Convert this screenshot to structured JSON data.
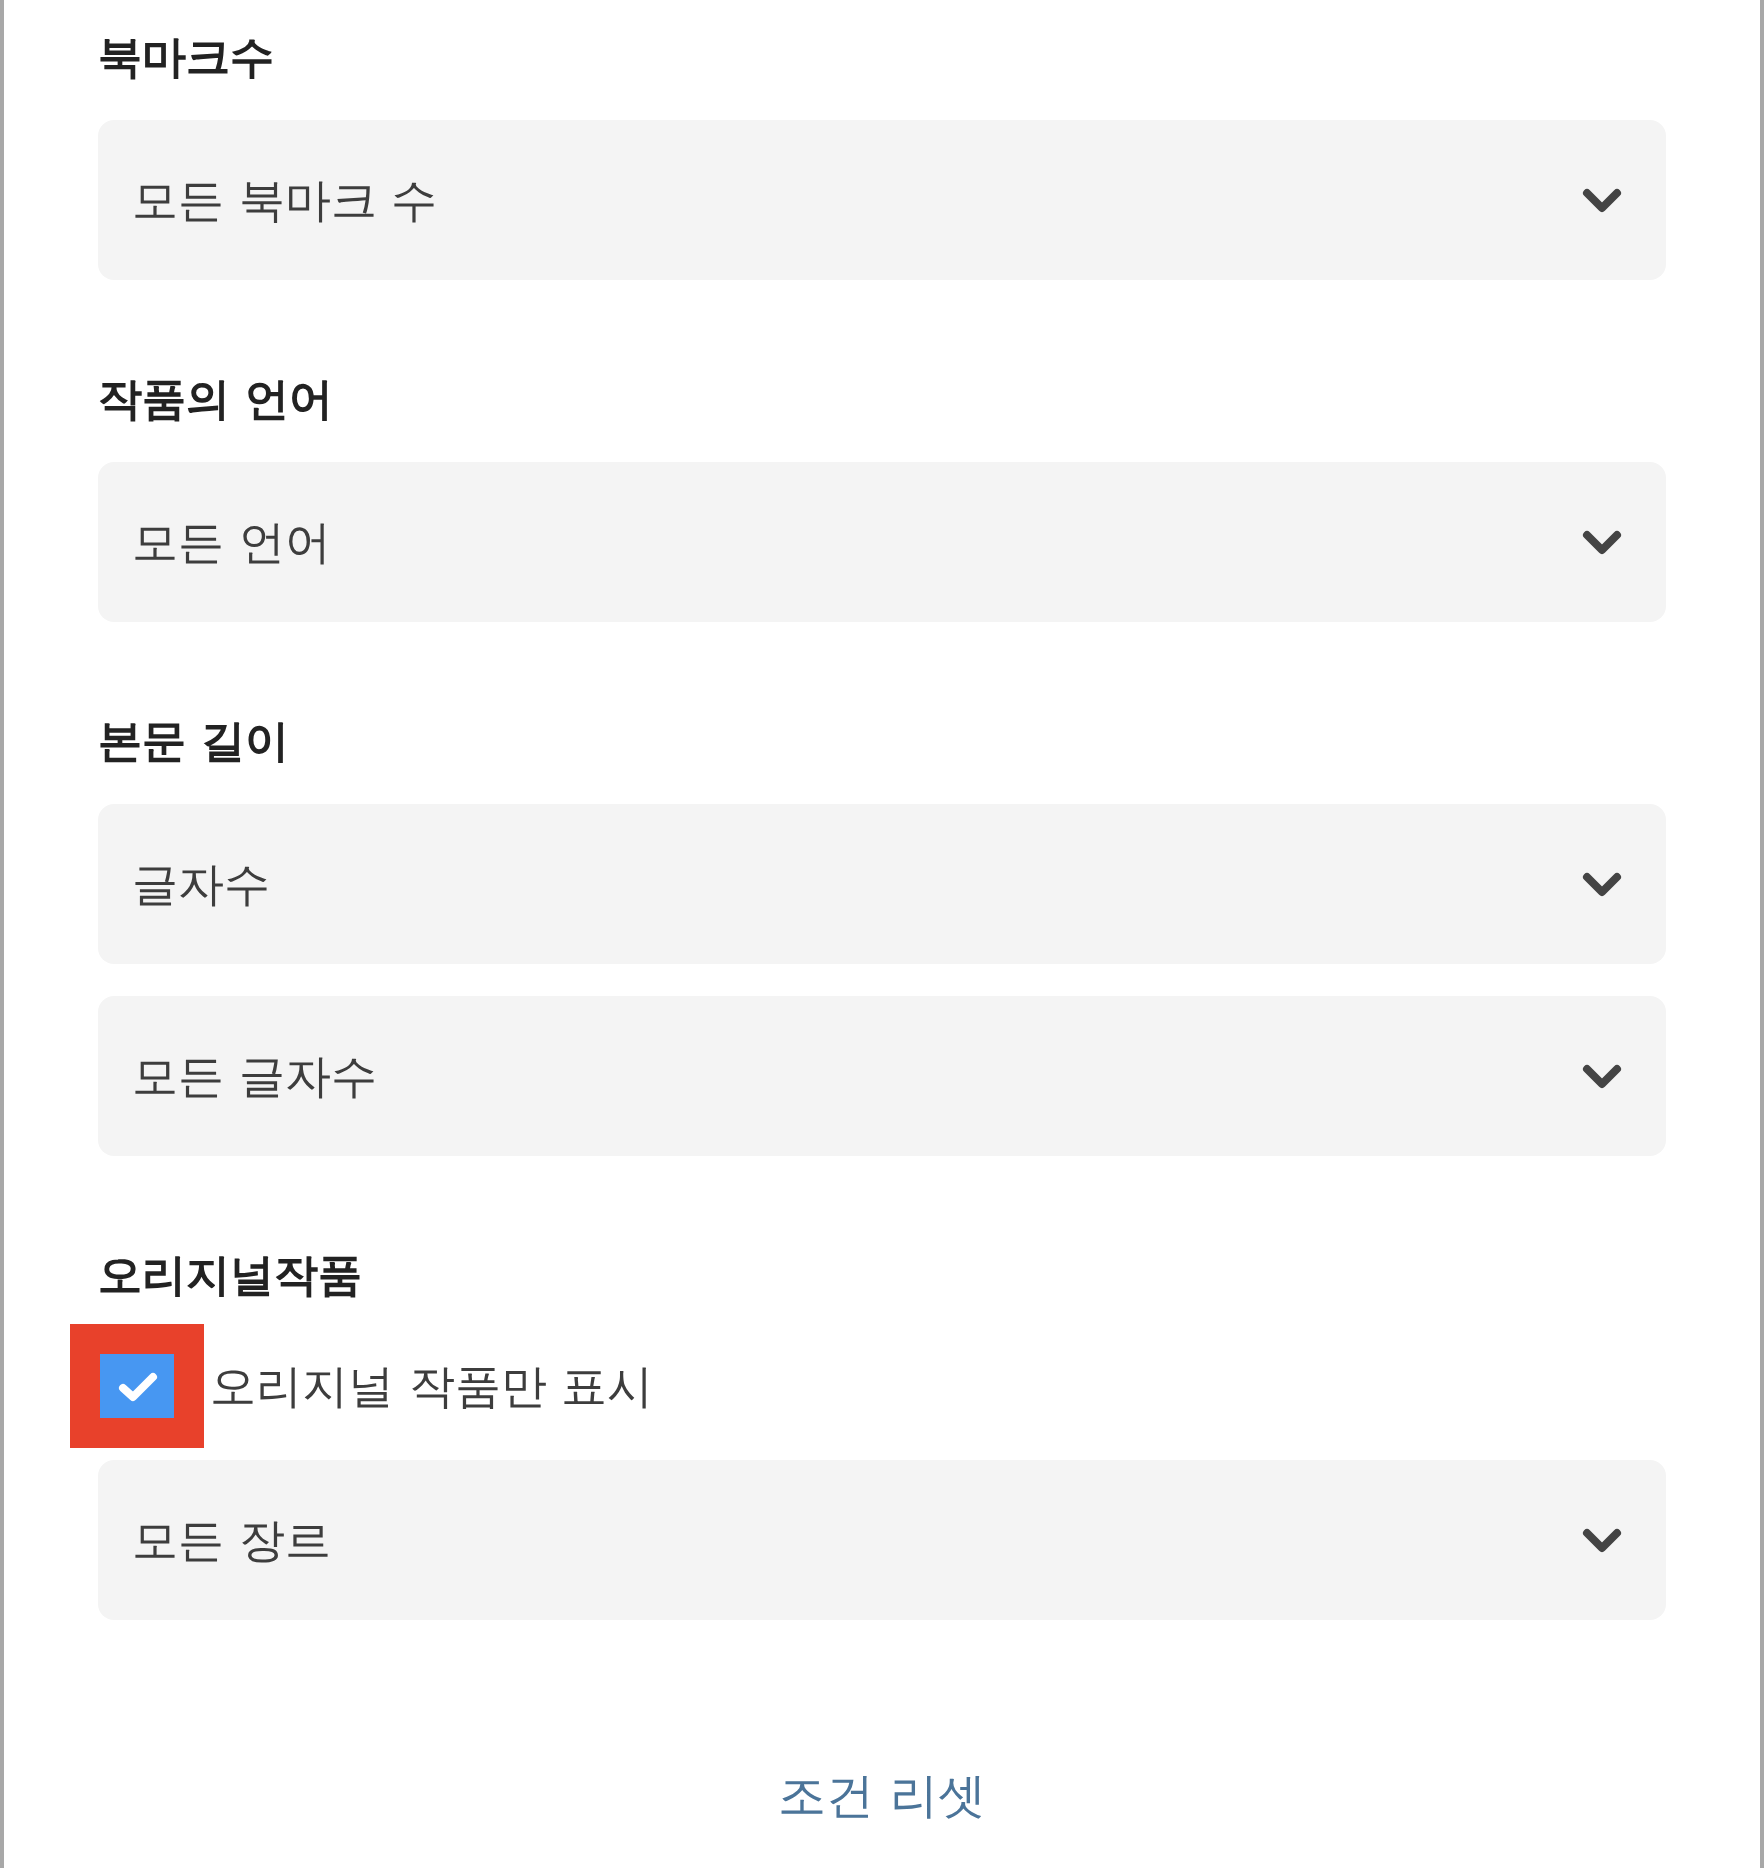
{
  "sections": [
    {
      "label": "북마크수",
      "selects": [
        {
          "value": "모든 북마크 수"
        }
      ]
    },
    {
      "label": "작품의 언어",
      "selects": [
        {
          "value": "모든 언어"
        }
      ]
    },
    {
      "label": "본문 길이",
      "selects": [
        {
          "value": "글자수"
        },
        {
          "value": "모든 글자수"
        }
      ]
    },
    {
      "label": "오리지널작품",
      "checkbox": {
        "label": "오리지널 작품만 표시",
        "checked": true,
        "highlighted": true
      },
      "selects": [
        {
          "value": "모든 장르"
        }
      ]
    }
  ],
  "reset_link": "조건 리셋"
}
